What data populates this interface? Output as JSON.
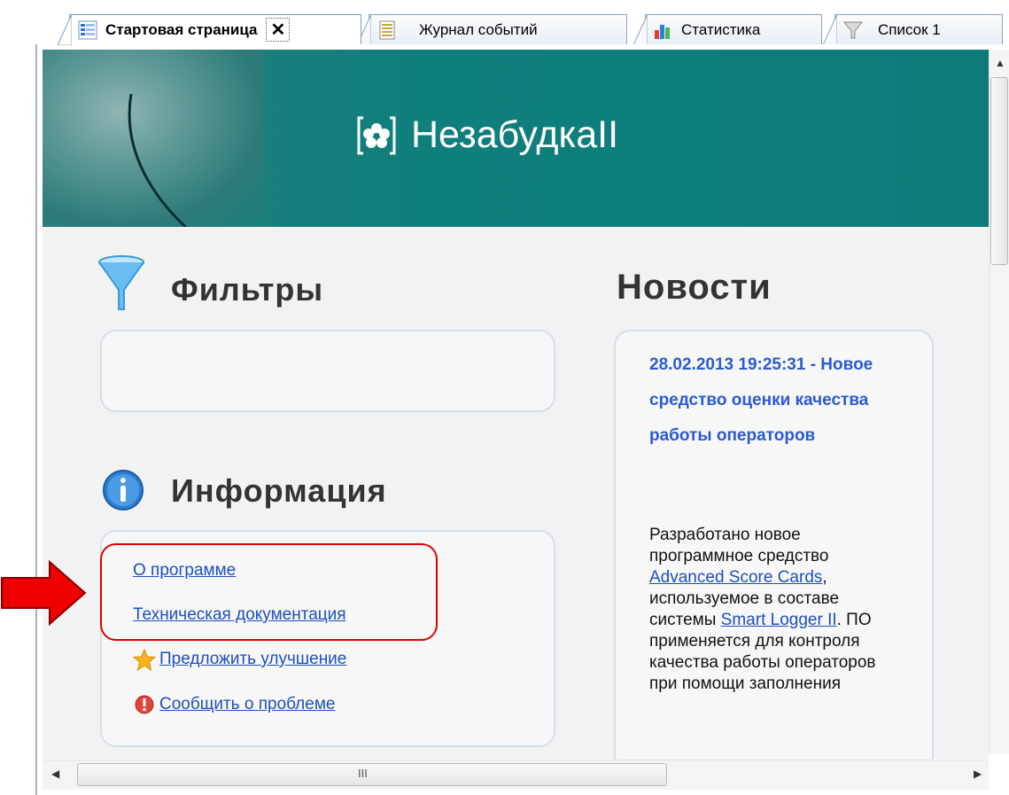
{
  "tabs": [
    {
      "label": "Стартовая страница",
      "icon": "start-page-icon",
      "active": true
    },
    {
      "label": "Журнал событий",
      "icon": "event-log-icon",
      "active": false
    },
    {
      "label": "Статистика",
      "icon": "statistics-icon",
      "active": false
    },
    {
      "label": "Список 1",
      "icon": "filter-list-icon",
      "active": false
    }
  ],
  "tab_close": "✕",
  "banner": {
    "logo_text": "НезабудкаII"
  },
  "filters": {
    "title": "Фильтры"
  },
  "info": {
    "title": "Информация",
    "links": {
      "about": "О программе",
      "docs": "Техническая документация",
      "suggest": "Предложить улучшение",
      "report": "Сообщить о проблеме"
    }
  },
  "news": {
    "title": "Новости",
    "item_title": "28.02.2013 19:25:31 - Новое средство оценки качества работы операторов",
    "body_before": "Разработано новое программное средство ",
    "link1": "Advanced Score Cards",
    "body_mid": ", используемое в составе системы ",
    "link2": "Smart Logger II",
    "body_after": ". ПО применяется для контроля качества работы операторов при помощи заполнения"
  },
  "hscroll_grip": "III",
  "colors": {
    "banner": "#0d7c79",
    "link": "#1c4fbf",
    "news_title": "#2a5bd2",
    "highlight": "#e00000"
  }
}
